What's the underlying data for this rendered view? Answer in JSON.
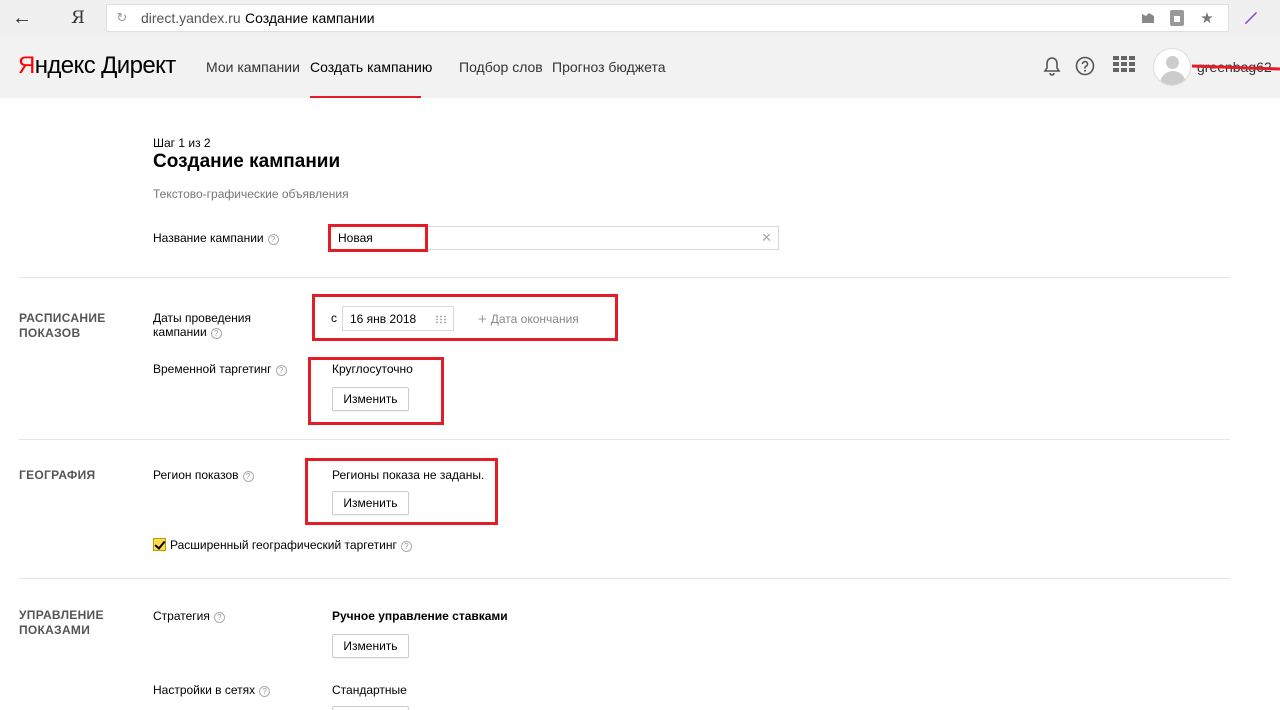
{
  "browser": {
    "back_glyph": "←",
    "yandex_glyph": "Я",
    "reload_glyph": "↻",
    "domain": "direct.yandex.ru",
    "title": "Создание кампании",
    "icons": [
      "flag-icon",
      "lock-icon",
      "star-icon",
      "pen-icon"
    ]
  },
  "header": {
    "logo_ya": "Я",
    "logo_rest": "ндекс",
    "logo_product": "Директ",
    "nav": [
      {
        "label": "Мои кампании",
        "active": false
      },
      {
        "label": "Создать кампанию",
        "active": true
      },
      {
        "label": "Подбор слов",
        "active": false
      },
      {
        "label": "Прогноз бюджета",
        "active": false
      }
    ],
    "username": "greenbag62",
    "accent_color": "#e41c27"
  },
  "page": {
    "step": "Шаг 1 из 2",
    "title": "Создание кампании",
    "subtitle": "Текстово-графические объявления",
    "campaign_name_label": "Название кампании",
    "campaign_name_value": "Новая"
  },
  "schedule": {
    "section_title_line1": "РАСПИСАНИЕ",
    "section_title_line2": "ПОКАЗОВ",
    "dates_label_line1": "Даты проведения",
    "dates_label_line2": "кампании",
    "from_label": "с",
    "start_date": "16 янв 2018",
    "end_date_label": "Дата окончания",
    "time_targeting_label": "Временной таргетинг",
    "time_targeting_value": "Круглосуточно",
    "change_button": "Изменить"
  },
  "geography": {
    "section_title": "ГЕОГРАФИЯ",
    "region_label": "Регион показов",
    "region_value": "Регионы показа не заданы.",
    "change_button": "Изменить",
    "extended_geo_label": "Расширенный географический таргетинг",
    "extended_geo_checked": true
  },
  "management": {
    "section_title_line1": "УПРАВЛЕНИЕ",
    "section_title_line2": "ПОКАЗАМИ",
    "strategy_label": "Стратегия",
    "strategy_value": "Ручное управление ставками",
    "change_button": "Изменить",
    "network_label": "Настройки в сетях",
    "network_value": "Стандартные"
  }
}
